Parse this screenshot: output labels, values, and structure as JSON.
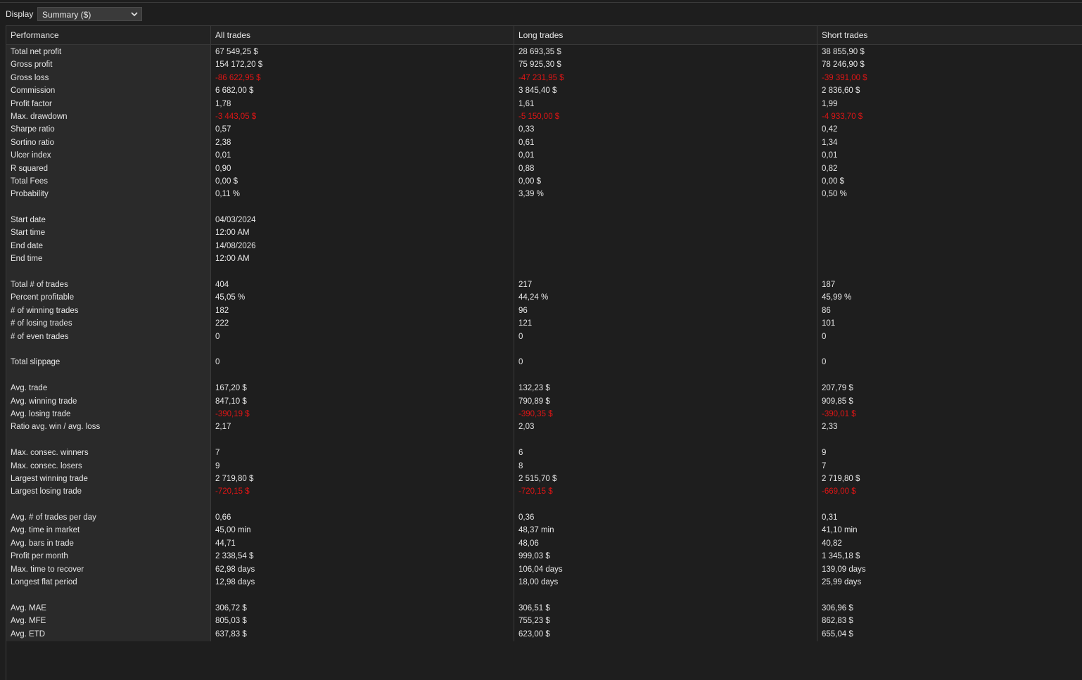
{
  "toolbar": {
    "display_label": "Display",
    "display_value": "Summary ($)"
  },
  "columns": [
    "Performance",
    "All trades",
    "Long trades",
    "Short trades"
  ],
  "rows": [
    {
      "label": "Total net profit",
      "values": [
        "67 549,25 $",
        "28 693,35 $",
        "38 855,90 $"
      ]
    },
    {
      "label": "Gross profit",
      "values": [
        "154 172,20 $",
        "75 925,30 $",
        "78 246,90 $"
      ]
    },
    {
      "label": "Gross loss",
      "values": [
        "-86 622,95 $",
        "-47 231,95 $",
        "-39 391,00 $"
      ],
      "negative": true
    },
    {
      "label": "Commission",
      "values": [
        "6 682,00 $",
        "3 845,40 $",
        "2 836,60 $"
      ]
    },
    {
      "label": "Profit factor",
      "values": [
        "1,78",
        "1,61",
        "1,99"
      ]
    },
    {
      "label": "Max. drawdown",
      "values": [
        "-3 443,05 $",
        "-5 150,00 $",
        "-4 933,70 $"
      ],
      "negative": true
    },
    {
      "label": "Sharpe ratio",
      "values": [
        "0,57",
        "0,33",
        "0,42"
      ]
    },
    {
      "label": "Sortino ratio",
      "values": [
        "2,38",
        "0,61",
        "1,34"
      ]
    },
    {
      "label": "Ulcer index",
      "values": [
        "0,01",
        "0,01",
        "0,01"
      ]
    },
    {
      "label": "R squared",
      "values": [
        "0,90",
        "0,88",
        "0,82"
      ]
    },
    {
      "label": "Total Fees",
      "values": [
        "0,00 $",
        "0,00 $",
        "0,00 $"
      ]
    },
    {
      "label": "Probability",
      "values": [
        "0,11 %",
        "3,39 %",
        "0,50 %"
      ]
    },
    {
      "label": "",
      "values": [
        "",
        "",
        ""
      ]
    },
    {
      "label": "Start date",
      "values": [
        "04/03/2024",
        "",
        ""
      ]
    },
    {
      "label": "Start time",
      "values": [
        "12:00 AM",
        "",
        ""
      ]
    },
    {
      "label": "End date",
      "values": [
        "14/08/2026",
        "",
        ""
      ]
    },
    {
      "label": "End time",
      "values": [
        "12:00 AM",
        "",
        ""
      ]
    },
    {
      "label": "",
      "values": [
        "",
        "",
        ""
      ]
    },
    {
      "label": "Total # of trades",
      "values": [
        "404",
        "217",
        "187"
      ]
    },
    {
      "label": "Percent profitable",
      "values": [
        "45,05 %",
        "44,24 %",
        "45,99 %"
      ]
    },
    {
      "label": "# of winning trades",
      "values": [
        "182",
        "96",
        "86"
      ]
    },
    {
      "label": "# of losing trades",
      "values": [
        "222",
        "121",
        "101"
      ]
    },
    {
      "label": "# of even trades",
      "values": [
        "0",
        "0",
        "0"
      ]
    },
    {
      "label": "",
      "values": [
        "",
        "",
        ""
      ]
    },
    {
      "label": "Total slippage",
      "values": [
        "0",
        "0",
        "0"
      ]
    },
    {
      "label": "",
      "values": [
        "",
        "",
        ""
      ]
    },
    {
      "label": "Avg. trade",
      "values": [
        "167,20 $",
        "132,23 $",
        "207,79 $"
      ]
    },
    {
      "label": "Avg. winning trade",
      "values": [
        "847,10 $",
        "790,89 $",
        "909,85 $"
      ]
    },
    {
      "label": "Avg. losing trade",
      "values": [
        "-390,19 $",
        "-390,35 $",
        "-390,01 $"
      ],
      "negative": true
    },
    {
      "label": "Ratio avg. win / avg. loss",
      "values": [
        "2,17",
        "2,03",
        "2,33"
      ]
    },
    {
      "label": "",
      "values": [
        "",
        "",
        ""
      ]
    },
    {
      "label": "Max. consec. winners",
      "values": [
        "7",
        "6",
        "9"
      ]
    },
    {
      "label": "Max. consec. losers",
      "values": [
        "9",
        "8",
        "7"
      ]
    },
    {
      "label": "Largest winning trade",
      "values": [
        "2 719,80 $",
        "2 515,70 $",
        "2 719,80 $"
      ]
    },
    {
      "label": "Largest losing trade",
      "values": [
        "-720,15 $",
        "-720,15 $",
        "-669,00 $"
      ],
      "negative": true
    },
    {
      "label": "",
      "values": [
        "",
        "",
        ""
      ]
    },
    {
      "label": "Avg. # of trades per day",
      "values": [
        "0,66",
        "0,36",
        "0,31"
      ]
    },
    {
      "label": "Avg. time in market",
      "values": [
        "45,00 min",
        "48,37 min",
        "41,10 min"
      ]
    },
    {
      "label": "Avg. bars in trade",
      "values": [
        "44,71",
        "48,06",
        "40,82"
      ]
    },
    {
      "label": "Profit per month",
      "values": [
        "2 338,54 $",
        "999,03 $",
        "1 345,18 $"
      ]
    },
    {
      "label": "Max. time to recover",
      "values": [
        "62,98 days",
        "106,04 days",
        "139,09 days"
      ]
    },
    {
      "label": "Longest flat period",
      "values": [
        "12,98 days",
        "18,00 days",
        "25,99 days"
      ]
    },
    {
      "label": "",
      "values": [
        "",
        "",
        ""
      ]
    },
    {
      "label": "Avg. MAE",
      "values": [
        "306,72 $",
        "306,51 $",
        "306,96 $"
      ]
    },
    {
      "label": "Avg. MFE",
      "values": [
        "805,03 $",
        "755,23 $",
        "862,83 $"
      ]
    },
    {
      "label": "Avg. ETD",
      "values": [
        "637,83 $",
        "623,00 $",
        "655,04 $"
      ]
    }
  ]
}
